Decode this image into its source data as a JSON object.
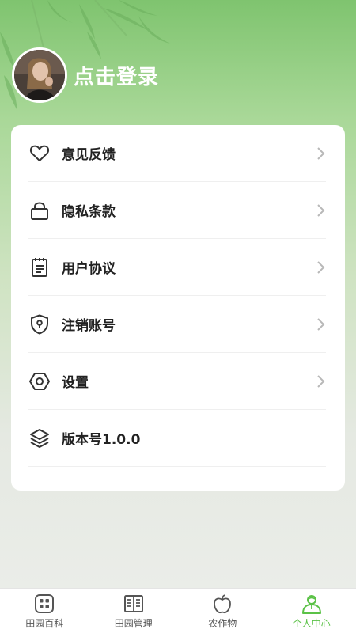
{
  "header": {
    "avatar_icon": "user-avatar-photo",
    "login_text": "点击登录"
  },
  "menu": {
    "items": [
      {
        "label": "意见反馈",
        "icon": "heart-icon",
        "chevron": true
      },
      {
        "label": "隐私条款",
        "icon": "lock-icon",
        "chevron": true
      },
      {
        "label": "用户协议",
        "icon": "notepad-icon",
        "chevron": true
      },
      {
        "label": "注销账号",
        "icon": "shield-keyhole-icon",
        "chevron": true
      },
      {
        "label": "设置",
        "icon": "hexagon-nut-icon",
        "chevron": true
      },
      {
        "label": "版本号1.0.0",
        "icon": "layers-icon",
        "chevron": false
      }
    ]
  },
  "tabbar": {
    "tabs": [
      {
        "label": "田园百科",
        "icon": "grid-icon",
        "active": false
      },
      {
        "label": "田园管理",
        "icon": "book-icon",
        "active": false
      },
      {
        "label": "农作物",
        "icon": "apple-icon",
        "active": false
      },
      {
        "label": "个人中心",
        "icon": "person-icon",
        "active": true
      }
    ]
  },
  "colors": {
    "accent": "#5bc247",
    "header_green": "#7fc46f",
    "text_dark": "#222222",
    "icon_grey": "#333333",
    "chevron_grey": "#b8b8b8"
  }
}
